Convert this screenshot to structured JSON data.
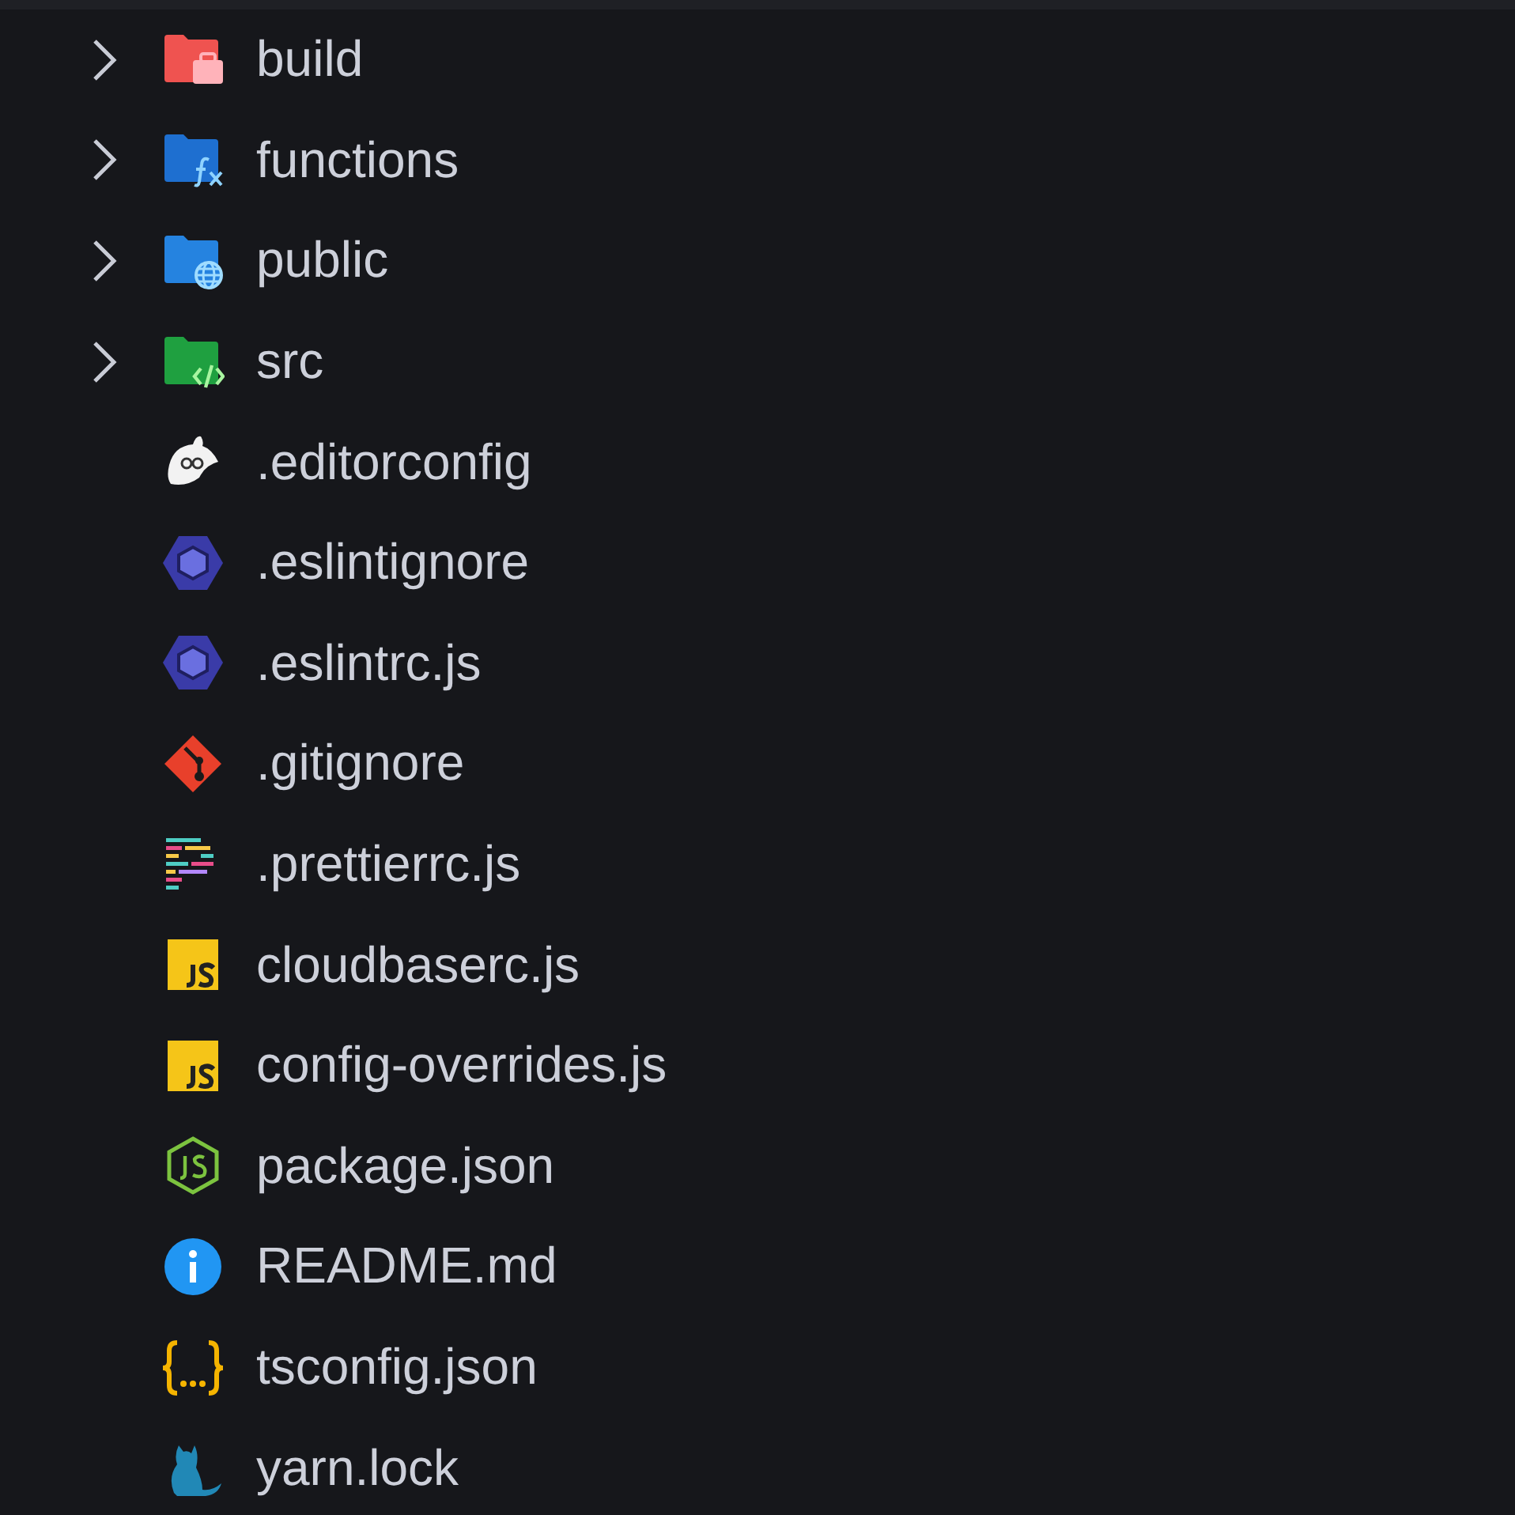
{
  "explorer": {
    "items": [
      {
        "kind": "folder",
        "name": "build",
        "expanded": false
      },
      {
        "kind": "folder",
        "name": "functions",
        "expanded": false
      },
      {
        "kind": "folder",
        "name": "public",
        "expanded": false
      },
      {
        "kind": "folder",
        "name": "src",
        "expanded": false
      },
      {
        "kind": "file",
        "name": ".editorconfig"
      },
      {
        "kind": "file",
        "name": ".eslintignore"
      },
      {
        "kind": "file",
        "name": ".eslintrc.js"
      },
      {
        "kind": "file",
        "name": ".gitignore"
      },
      {
        "kind": "file",
        "name": ".prettierrc.js"
      },
      {
        "kind": "file",
        "name": "cloudbaserc.js"
      },
      {
        "kind": "file",
        "name": "config-overrides.js"
      },
      {
        "kind": "file",
        "name": "package.json"
      },
      {
        "kind": "file",
        "name": "README.md"
      },
      {
        "kind": "file",
        "name": "tsconfig.json"
      },
      {
        "kind": "file",
        "name": "yarn.lock"
      }
    ]
  }
}
